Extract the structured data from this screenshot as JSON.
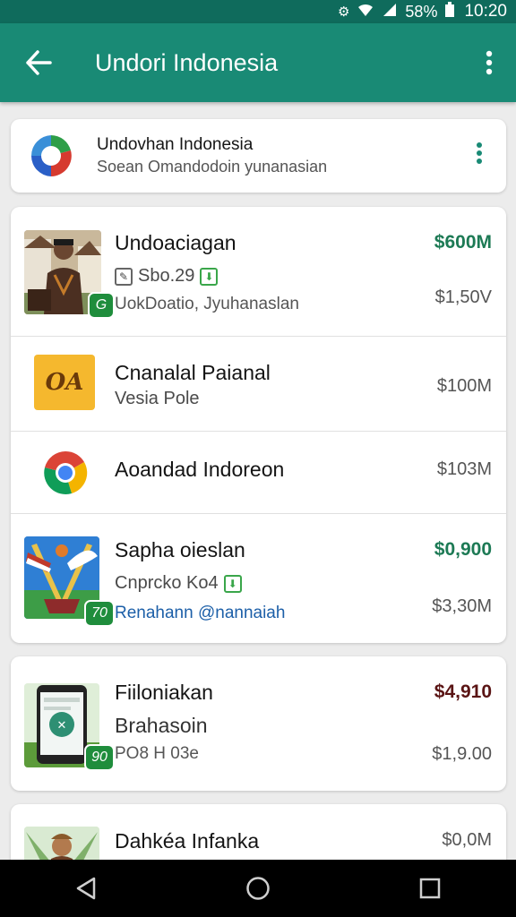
{
  "status_bar": {
    "battery": "58%",
    "time": "10:20"
  },
  "app_bar": {
    "title": "Undori Indonesia"
  },
  "header_card": {
    "title": "Undovhan Indonesia",
    "subtitle": "Soean Omandodoin yunanasian"
  },
  "list_card_1": {
    "rows": [
      {
        "name": "Undoaciagan",
        "line2": "Sbo.29",
        "line3": "UokDoatio, Jyuhanaslan",
        "price_top": "$600M",
        "price": "$1,50V",
        "badge": "G"
      },
      {
        "name": "Cnanalal Paianal",
        "line2": "Vesia Pole",
        "price": "$100M",
        "thumb_text": "OA"
      },
      {
        "name": "Aoandad Indoreon",
        "price": "$103M"
      },
      {
        "name": "Sapha oieslan",
        "line2": "Cnprcko Ko4",
        "line3": "Renahann @nannaiah",
        "price_top": "$0,900",
        "price": "$3,30M",
        "badge": "70"
      }
    ]
  },
  "list_card_2": {
    "rows": [
      {
        "name": "Fiiloniakan",
        "line2": "Brahasoin",
        "line3": "PO8 H 03e",
        "price_top": "$4,910",
        "price": "$1,9.00",
        "badge": "90"
      }
    ]
  },
  "list_card_3": {
    "rows": [
      {
        "name": "Dahkéa Infanka",
        "price": "$0,0M"
      }
    ]
  },
  "colors": {
    "primary": "#198a75",
    "status": "#0f6b5c",
    "green_price": "#1d7a55",
    "dark_price": "#5a1414",
    "badge": "#1f8d3c"
  }
}
